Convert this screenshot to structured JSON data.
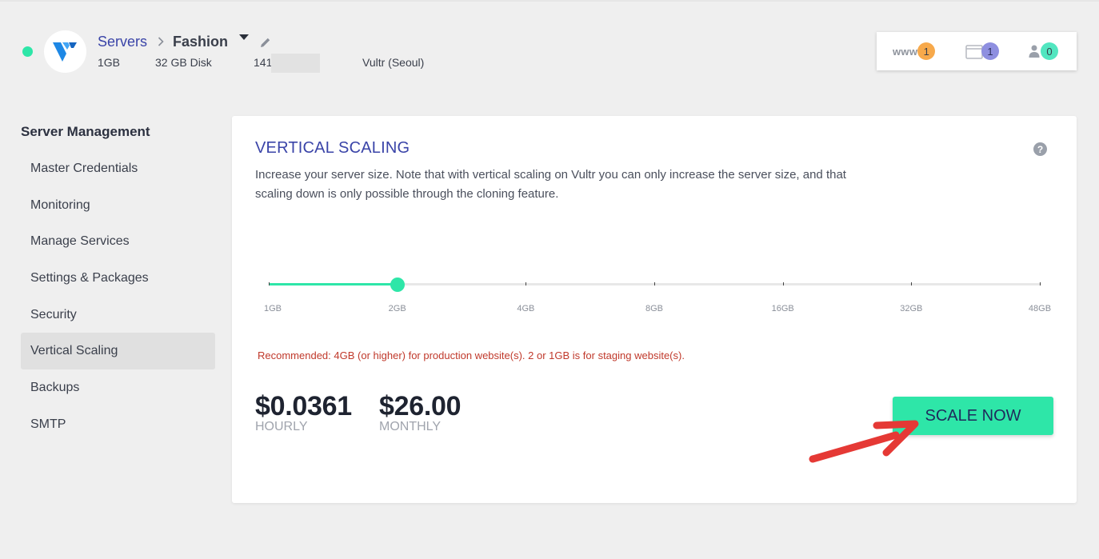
{
  "header": {
    "breadcrumb_parent": "Servers",
    "breadcrumb_current": "Fashion",
    "ram": "1GB",
    "disk": "32 GB Disk",
    "ip_visible": "141.",
    "provider": "Vultr (Seoul)"
  },
  "counters": {
    "www_label": "www",
    "www_count": "1",
    "files_count": "1",
    "users_count": "0",
    "colors": {
      "www": "#f7a94b",
      "files": "#8e8fe0",
      "users": "#52e6c0"
    }
  },
  "sidebar": {
    "title": "Server Management",
    "items": [
      {
        "label": "Master Credentials"
      },
      {
        "label": "Monitoring"
      },
      {
        "label": "Manage Services"
      },
      {
        "label": "Settings & Packages"
      },
      {
        "label": "Security"
      },
      {
        "label": "Vertical Scaling",
        "active": true
      },
      {
        "label": "Backups"
      },
      {
        "label": "SMTP"
      }
    ]
  },
  "main": {
    "title": "VERTICAL SCALING",
    "help_icon": "?",
    "description": "Increase your server size. Note that with vertical scaling on Vultr you can only increase the server size, and that scaling down is only possible through the cloning feature.",
    "slider": {
      "ticks": [
        "1GB",
        "2GB",
        "4GB",
        "8GB",
        "16GB",
        "32GB",
        "48GB"
      ],
      "selected_index": 1,
      "accent": "#2ee6a8"
    },
    "recommendation": "Recommended: 4GB (or higher) for production website(s). 2 or 1GB is for staging website(s).",
    "hourly_price": "$0.0361",
    "hourly_label": "HOURLY",
    "monthly_price": "$26.00",
    "monthly_label": "MONTHLY",
    "scale_button": "SCALE NOW"
  }
}
